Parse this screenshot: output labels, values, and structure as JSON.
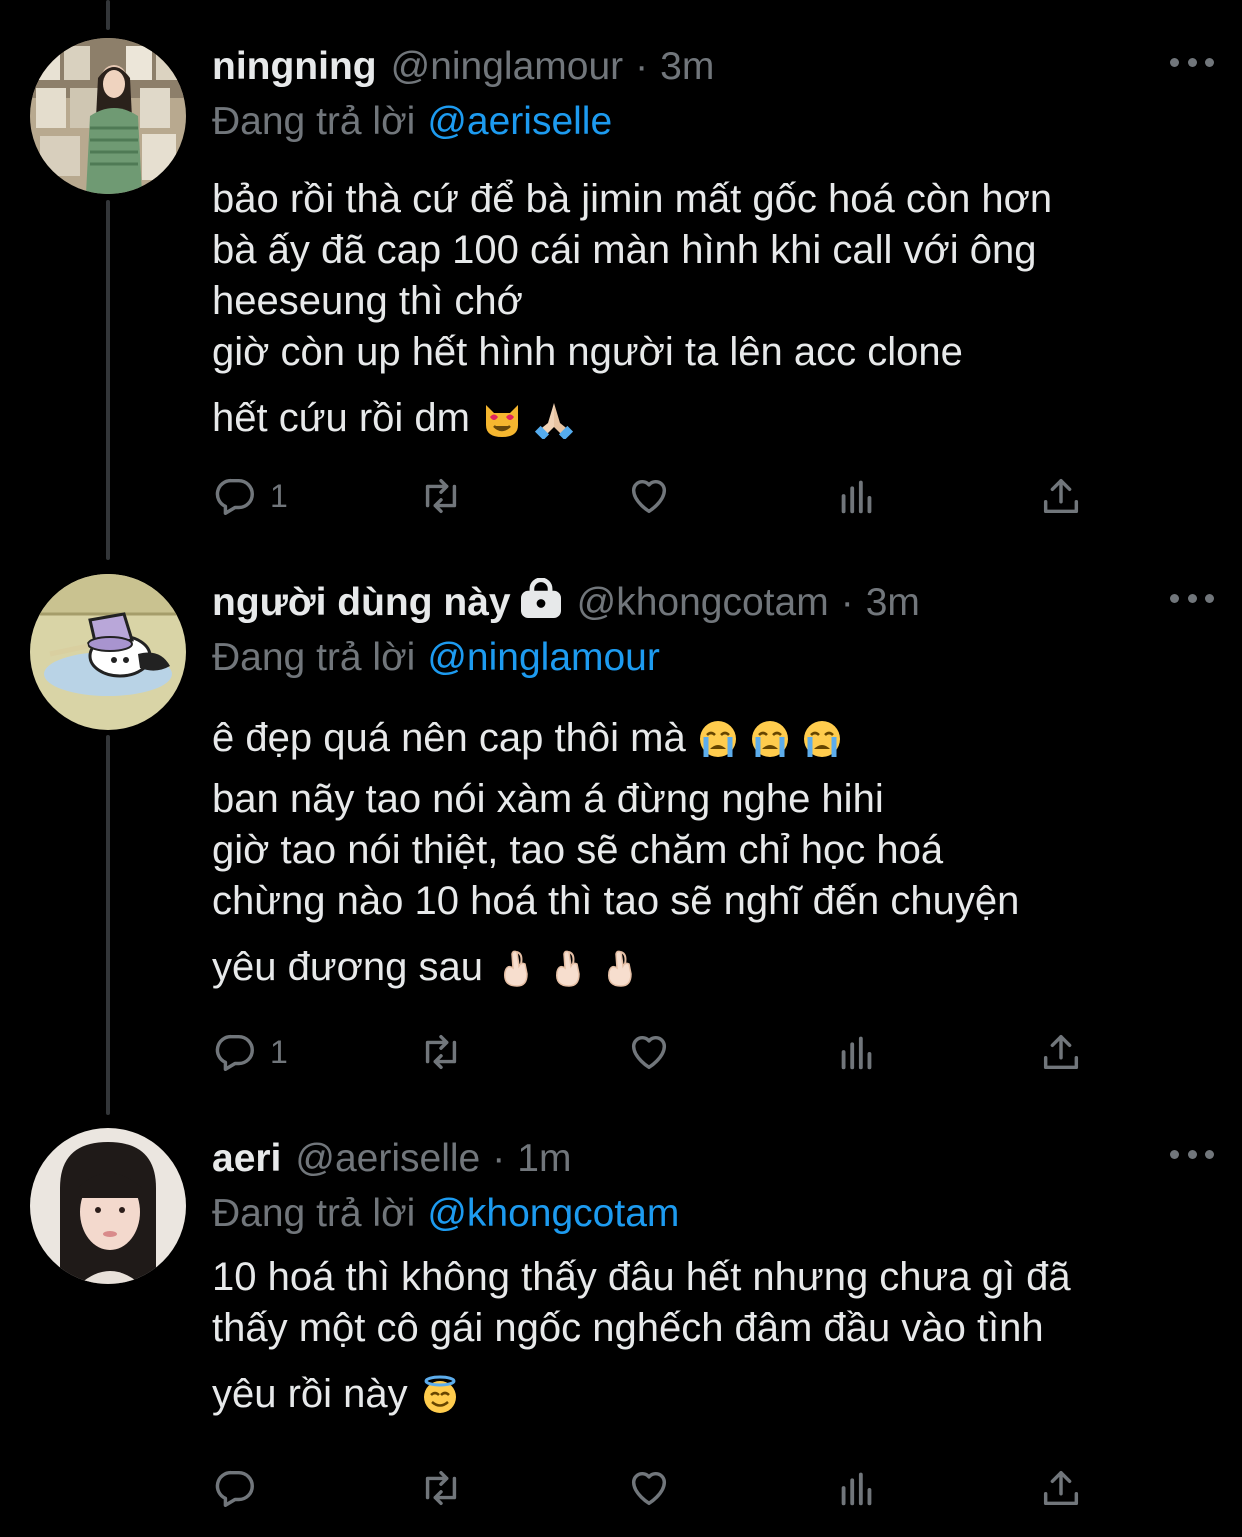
{
  "tweets": [
    {
      "name": "ningning",
      "handle": "@ninglamour",
      "dot": "·",
      "time": "3m",
      "reply_label": "Đang trả lời",
      "reply_handle": "@aeriselle",
      "lines": [
        "bảo rồi thà cứ để bà jimin mất gốc hoá còn hơn",
        "bà ấy đã cap 100 cái màn hình khi call với ông",
        "heeseung thì chớ",
        "giờ còn up hết hình người ta lên acc clone",
        "hết cứu rồi dm"
      ],
      "emojis": [
        "heart-eyes-cat-emoji",
        "folded-hands-emoji"
      ],
      "reply_count": "1",
      "locked": false
    },
    {
      "name": "người dùng này",
      "handle": "@khongcotam",
      "dot": "·",
      "time": "3m",
      "reply_label": "Đang trả lời",
      "reply_handle": "@ninglamour",
      "lines": [
        "ê đẹp quá nên cap thôi mà",
        "ban nãy tao nói xàm á đừng nghe hihi",
        "giờ tao nói thiệt, tao sẽ chăm chỉ học hoá",
        "chừng nào 10 hoá thì tao sẽ nghĩ đến chuyện",
        "yêu đương sau"
      ],
      "emojis_line1": [
        "crying-face-emoji",
        "crying-face-emoji",
        "crying-face-emoji"
      ],
      "emojis_last": [
        "crossed-fingers-emoji",
        "crossed-fingers-emoji",
        "crossed-fingers-emoji"
      ],
      "reply_count": "1",
      "locked": true
    },
    {
      "name": "aeri",
      "handle": "@aeriselle",
      "dot": "·",
      "time": "1m",
      "reply_label": "Đang trả lời",
      "reply_handle": "@khongcotam",
      "lines": [
        "10 hoá thì không thấy đâu hết nhưng chưa gì đã",
        "thấy một cô gái ngốc nghếch đâm đầu vào tình",
        "yêu rồi này"
      ],
      "emojis": [
        "smiling-face-with-halo-emoji"
      ],
      "reply_count": "",
      "locked": false
    }
  ],
  "colors": {
    "background": "#000000",
    "text": "#e7e9ea",
    "muted": "#71767b",
    "link": "#1d9bf0",
    "thread_line": "#333639"
  }
}
